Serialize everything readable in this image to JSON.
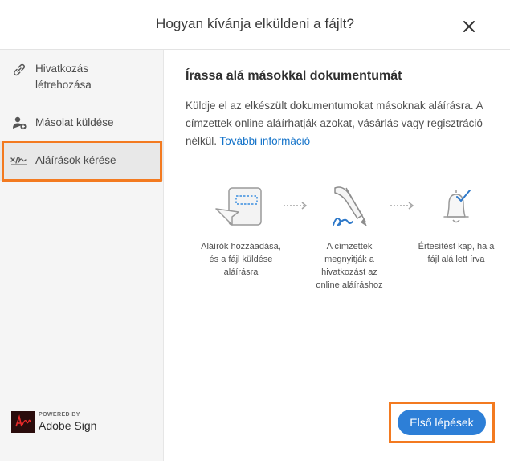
{
  "dialog": {
    "title": "Hogyan kívánja elküldeni a fájlt?"
  },
  "sidebar": {
    "items": [
      {
        "label_line1": "Hivatkozás",
        "label_line2": "létrehozása",
        "icon": "link-icon"
      },
      {
        "label": "Másolat küldése",
        "icon": "add-person-icon"
      },
      {
        "label": "Aláírások kérése",
        "icon": "signature-icon",
        "selected": true
      }
    ]
  },
  "brand": {
    "powered_by": "POWERED BY",
    "name": "Adobe Sign"
  },
  "main": {
    "heading": "Írassa alá másokkal dokumentumát",
    "description": "Küldje el az elkészült dokumentumokat másoknak aláírásra. A címzettek online aláírhatják azokat, vásárlás vagy regisztráció nélkül.",
    "link_text": "További információ",
    "steps": [
      {
        "line1": "Aláírók hozzáadása,",
        "line2": "és a fájl küldése",
        "line3": "aláírásra",
        "icon": "send-document-icon"
      },
      {
        "line1": "A címzettek",
        "line2": "megnyitják a",
        "line3": "hivatkozást az",
        "line4": "online aláíráshoz",
        "icon": "hand-signing-icon"
      },
      {
        "line1": "Értesítést kap, ha a",
        "line2": "fájl alá lett írva",
        "icon": "bell-check-icon"
      }
    ]
  },
  "footer": {
    "cta_label": "Első lépések"
  },
  "colors": {
    "accent": "#2d7fd7",
    "link": "#1473c9",
    "highlight": "#f37a20"
  }
}
